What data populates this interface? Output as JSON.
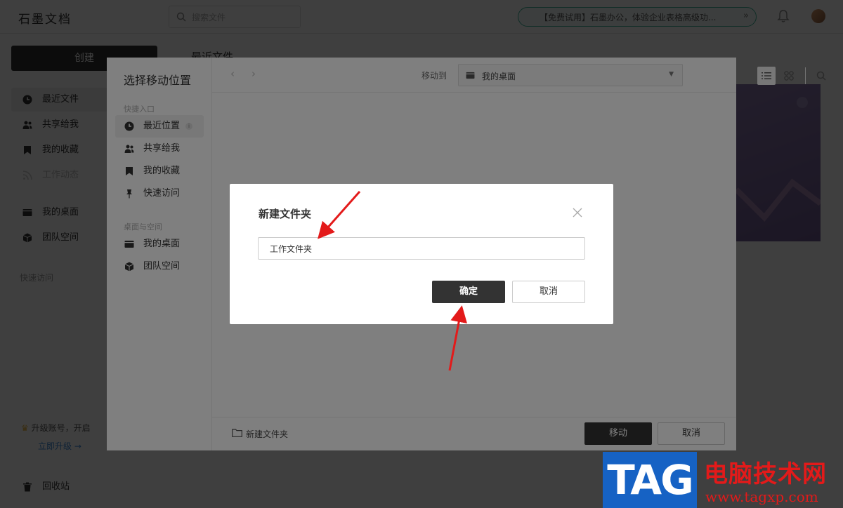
{
  "app": {
    "logo": "石墨文档",
    "search_placeholder": "搜索文件",
    "promo_text": "【免费试用】石墨办公，体验企业表格高级功...",
    "create_label": "创建",
    "nav": [
      "最近文件",
      "共享给我",
      "我的收藏",
      "工作动态"
    ],
    "nav2": [
      "我的桌面",
      "团队空间"
    ],
    "quick_access_label": "快速访问",
    "upgrade_text": "升级账号，开启",
    "upgrade_link": "立即升级 →",
    "trash_label": "回收站",
    "main_title": "最近文件"
  },
  "move_dialog": {
    "title": "选择移动位置",
    "quick_entry_label": "快捷入口",
    "quick_items": [
      {
        "label": "最近位置",
        "icon": "clock-icon"
      },
      {
        "label": "共享给我",
        "icon": "users-icon"
      },
      {
        "label": "我的收藏",
        "icon": "bookmark-icon"
      },
      {
        "label": "快速访问",
        "icon": "pin-icon"
      }
    ],
    "desktop_space_label": "桌面与空间",
    "space_items": [
      {
        "label": "我的桌面",
        "icon": "desktop-icon"
      },
      {
        "label": "团队空间",
        "icon": "cube-icon"
      }
    ],
    "moveto_label": "移动到",
    "location_value": "我的桌面",
    "new_folder_label": "新建文件夹",
    "move_button": "移动",
    "cancel_button": "取消"
  },
  "new_folder_dialog": {
    "title": "新建文件夹",
    "input_value": "工作文件夹",
    "confirm_button": "确定",
    "cancel_button": "取消"
  },
  "watermark": {
    "tag": "TAG",
    "site_name": "电脑技术网",
    "url": "www.tagxp.com"
  },
  "colors": {
    "primary_dark": "#333333",
    "annotation_red": "#e31a1a",
    "promo_green": "#3fb59a",
    "watermark_blue": "#1662c4"
  }
}
